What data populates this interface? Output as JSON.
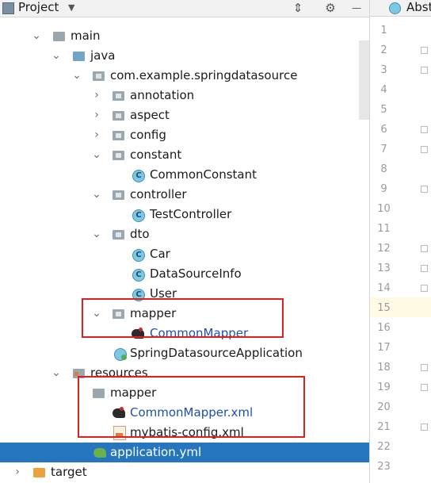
{
  "toolbar": {
    "title": "Project",
    "dropdown_icon": "triangle-down",
    "collapse_icon": "collapse-all",
    "settings_icon": "gear"
  },
  "editor": {
    "tab_label": "Abst",
    "line_numbers": [
      "1",
      "2",
      "3",
      "4",
      "5",
      "6",
      "7",
      "8",
      "9",
      "10",
      "11",
      "12",
      "13",
      "14",
      "15",
      "16",
      "17",
      "18",
      "19",
      "20",
      "21",
      "22",
      "23"
    ],
    "current_line": "15"
  },
  "tree": [
    {
      "label": "main",
      "kind": "folder",
      "expanded": true
    },
    {
      "label": "java",
      "kind": "folder-source",
      "expanded": true
    },
    {
      "label": "com.example.springdatasource",
      "kind": "package",
      "expanded": true
    },
    {
      "label": "annotation",
      "kind": "package",
      "expanded": false
    },
    {
      "label": "aspect",
      "kind": "package",
      "expanded": false
    },
    {
      "label": "config",
      "kind": "package",
      "expanded": false
    },
    {
      "label": "constant",
      "kind": "package",
      "expanded": true
    },
    {
      "label": "CommonConstant",
      "kind": "class"
    },
    {
      "label": "controller",
      "kind": "package",
      "expanded": true
    },
    {
      "label": "TestController",
      "kind": "class"
    },
    {
      "label": "dto",
      "kind": "package",
      "expanded": true
    },
    {
      "label": "Car",
      "kind": "class"
    },
    {
      "label": "DataSourceInfo",
      "kind": "class"
    },
    {
      "label": "User",
      "kind": "class"
    },
    {
      "label": "mapper",
      "kind": "package",
      "expanded": true
    },
    {
      "label": "CommonMapper",
      "kind": "mybatis-mapper"
    },
    {
      "label": "SpringDatasourceApplication",
      "kind": "spring-app-class"
    },
    {
      "label": "resources",
      "kind": "folder-resources",
      "expanded": true
    },
    {
      "label": "mapper",
      "kind": "folder",
      "expanded": false
    },
    {
      "label": "CommonMapper.xml",
      "kind": "mybatis-xml"
    },
    {
      "label": "mybatis-config.xml",
      "kind": "xml"
    },
    {
      "label": "application.yml",
      "kind": "yaml",
      "selected": true
    },
    {
      "label": "target",
      "kind": "folder-excluded",
      "expanded": false
    }
  ],
  "colors": {
    "selection": "#2675bf",
    "annotation_box": "#e02020",
    "link_text": "#1d4fb5"
  }
}
